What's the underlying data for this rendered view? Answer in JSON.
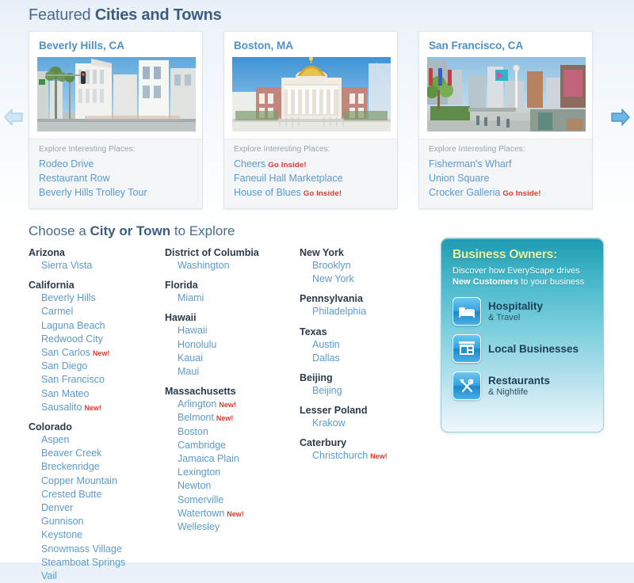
{
  "featured": {
    "title_plain": "Featured ",
    "title_strong": "Cities and Towns",
    "prev_arrow": "left-arrow-icon",
    "next_arrow": "right-arrow-icon",
    "explore_label": "Explore Interesting Places:",
    "cards": [
      {
        "title": "Beverly Hills, CA",
        "photo": "beverly-hills-street-photo",
        "places": [
          {
            "name": "Rodeo Drive",
            "badge": ""
          },
          {
            "name": "Restaurant Row",
            "badge": ""
          },
          {
            "name": "Beverly Hills Trolley Tour",
            "badge": ""
          }
        ]
      },
      {
        "title": "Boston, MA",
        "photo": "boston-state-house-photo",
        "places": [
          {
            "name": "Cheers",
            "badge": "Go Inside!"
          },
          {
            "name": "Faneuil Hall Marketplace",
            "badge": ""
          },
          {
            "name": "House of Blues",
            "badge": "Go Inside!"
          }
        ]
      },
      {
        "title": "San Francisco, CA",
        "photo": "san-francisco-union-square-photo",
        "places": [
          {
            "name": "Fisherman's Wharf",
            "badge": ""
          },
          {
            "name": "Union Square",
            "badge": ""
          },
          {
            "name": "Crocker Galleria",
            "badge": "Go Inside!"
          }
        ]
      }
    ]
  },
  "choose": {
    "title_a": "Choose a ",
    "title_strong": "City or Town",
    "title_b": " to Explore",
    "columns": [
      {
        "states": [
          {
            "name": "Arizona",
            "cities": [
              {
                "name": "Sierra Vista",
                "badge": ""
              }
            ]
          },
          {
            "name": "California",
            "cities": [
              {
                "name": "Beverly Hills",
                "badge": ""
              },
              {
                "name": "Carmel",
                "badge": ""
              },
              {
                "name": "Laguna Beach",
                "badge": ""
              },
              {
                "name": "Redwood City",
                "badge": ""
              },
              {
                "name": "San Carlos",
                "badge": "New!"
              },
              {
                "name": "San Diego",
                "badge": ""
              },
              {
                "name": "San Francisco",
                "badge": ""
              },
              {
                "name": "San Mateo",
                "badge": ""
              },
              {
                "name": "Sausalito",
                "badge": "New!"
              }
            ]
          },
          {
            "name": "Colorado",
            "cities": [
              {
                "name": "Aspen",
                "badge": ""
              },
              {
                "name": "Beaver Creek",
                "badge": ""
              },
              {
                "name": "Breckenridge",
                "badge": ""
              },
              {
                "name": "Copper Mountain",
                "badge": ""
              },
              {
                "name": "Crested Butte",
                "badge": ""
              },
              {
                "name": "Denver",
                "badge": ""
              },
              {
                "name": "Gunnison",
                "badge": ""
              },
              {
                "name": "Keystone",
                "badge": ""
              },
              {
                "name": "Snowmass Village",
                "badge": ""
              },
              {
                "name": "Steamboat Springs",
                "badge": ""
              },
              {
                "name": "Vail",
                "badge": ""
              }
            ]
          }
        ]
      },
      {
        "states": [
          {
            "name": "District of Columbia",
            "cities": [
              {
                "name": "Washington",
                "badge": ""
              }
            ]
          },
          {
            "name": "Florida",
            "cities": [
              {
                "name": "Miami",
                "badge": ""
              }
            ]
          },
          {
            "name": "Hawaii",
            "cities": [
              {
                "name": "Hawaii",
                "badge": ""
              },
              {
                "name": "Honolulu",
                "badge": ""
              },
              {
                "name": "Kauai",
                "badge": ""
              },
              {
                "name": "Maui",
                "badge": ""
              }
            ]
          },
          {
            "name": "Massachusetts",
            "cities": [
              {
                "name": "Arlington",
                "badge": "New!"
              },
              {
                "name": "Belmont",
                "badge": "New!"
              },
              {
                "name": "Boston",
                "badge": ""
              },
              {
                "name": "Cambridge",
                "badge": ""
              },
              {
                "name": "Jamaica Plain",
                "badge": ""
              },
              {
                "name": "Lexington",
                "badge": ""
              },
              {
                "name": "Newton",
                "badge": ""
              },
              {
                "name": "Somerville",
                "badge": ""
              },
              {
                "name": "Watertown",
                "badge": "New!"
              },
              {
                "name": "Wellesley",
                "badge": ""
              }
            ]
          }
        ]
      },
      {
        "states": [
          {
            "name": "New York",
            "cities": [
              {
                "name": "Brooklyn",
                "badge": ""
              },
              {
                "name": "New York",
                "badge": ""
              }
            ]
          },
          {
            "name": "Pennsylvania",
            "cities": [
              {
                "name": "Philadelphia",
                "badge": ""
              }
            ]
          },
          {
            "name": "Texas",
            "cities": [
              {
                "name": "Austin",
                "badge": ""
              },
              {
                "name": "Dallas",
                "badge": ""
              }
            ]
          },
          {
            "name": "Beijing",
            "cities": [
              {
                "name": "Beijing",
                "badge": ""
              }
            ]
          },
          {
            "name": "Lesser Poland",
            "cities": [
              {
                "name": "Krakow",
                "badge": ""
              }
            ]
          },
          {
            "name": "Caterbury",
            "cities": [
              {
                "name": "Christchurch",
                "badge": "New!"
              }
            ]
          }
        ]
      }
    ]
  },
  "business_panel": {
    "title": "Business Owners:",
    "sub_a": "Discover how EveryScape drives",
    "sub_b": "New Customers",
    "sub_c": " to your business",
    "items": [
      {
        "icon": "bed-icon",
        "line1": "Hospitality",
        "line2": "& Travel"
      },
      {
        "icon": "storefront-icon",
        "line1": "Local Businesses",
        "line2": ""
      },
      {
        "icon": "fork-knife-icon",
        "line1": "Restaurants",
        "line2": "& Nightlife"
      }
    ]
  },
  "colors": {
    "link_blue": "#5a9bcd",
    "heading_blue": "#3d5d80",
    "badge_red": "#e03a2f",
    "panel_title_yellow": "#e9f5a8",
    "panel_teal": "#1f9ab0"
  }
}
